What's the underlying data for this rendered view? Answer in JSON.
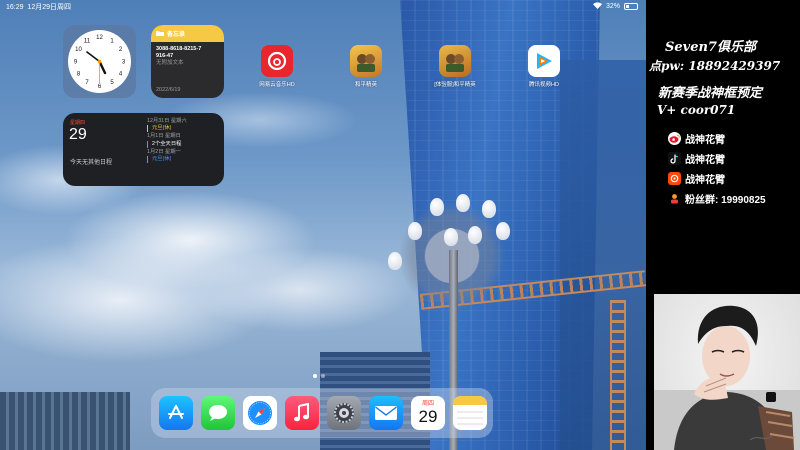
{
  "statusbar": {
    "time": "16:29",
    "date": "12月29日周四",
    "battery": "32%"
  },
  "widgets": {
    "notes": {
      "title": "备忘录",
      "lines": [
        "3088-8618-8215-7",
        "916-47",
        "无附加文本"
      ],
      "date": "2022/6/19"
    },
    "calendar": {
      "weekday": "星期四",
      "day": "29",
      "no_events": "今天无其他日程",
      "entries": [
        {
          "date": "12月31日 星期六",
          "event": "元旦(休)",
          "color": "#f4c430"
        },
        {
          "date": "1月1日 星期日",
          "event": "2个全天日程",
          "color": "#4a9cff"
        },
        {
          "date": "1月2日 星期一",
          "event": "元旦(休)",
          "color": "#4a9cff"
        }
      ]
    }
  },
  "home_apps": [
    {
      "name": "netease-music",
      "label": "网易云音乐HD",
      "color": "#e8262e"
    },
    {
      "name": "peace-elite",
      "label": "和平精英",
      "color": "#d39a2a"
    },
    {
      "name": "peace-elite-tiyan",
      "label": "[体验服]和平精英",
      "color": "#c98b2c"
    },
    {
      "name": "tencent-video",
      "label": "腾讯视频HD",
      "color": "#ffffff"
    }
  ],
  "dock": {
    "calendar_weekday": "周四",
    "calendar_day": "29",
    "apps": [
      "app-store",
      "messages",
      "safari",
      "music",
      "settings",
      "mail",
      "calendar",
      "notes"
    ]
  },
  "panel": {
    "club": "Seven7俱乐部",
    "pw": "点pw: 18892429397",
    "season": "新赛季战神框预定",
    "vx": "V+ coor071",
    "socials": [
      {
        "platform": "weibo-icon",
        "text": "战神花臂",
        "color": "#e6162d"
      },
      {
        "platform": "douyin-icon",
        "text": "战神花臂",
        "color": "#111111"
      },
      {
        "platform": "kuaishou-icon",
        "text": "战神花臂",
        "color": "#ff4906"
      },
      {
        "platform": "fans-group-icon",
        "text": "粉丝群: 19990825",
        "color": "#f0a020"
      }
    ]
  }
}
